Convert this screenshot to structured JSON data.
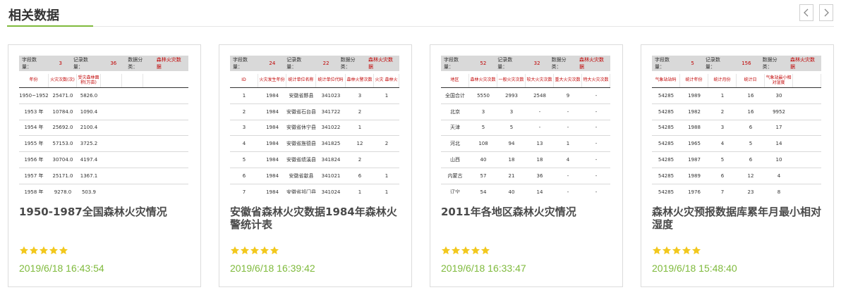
{
  "section": {
    "title": "相关数据",
    "accent_color": "#7fba3c"
  },
  "nav": {
    "prev_icon": "chevron-left-icon",
    "next_icon": "chevron-right-icon"
  },
  "meta_labels": {
    "fields": "字段数量：",
    "records": "记录数量：",
    "category": "数据分类："
  },
  "cards": [
    {
      "title": "1950-1987全国森林火灾情况",
      "date": "2019/6/18 16:43:54",
      "rating": 5,
      "thumb": {
        "fields": "3",
        "records": "36",
        "category": "森林火灾数据",
        "columns": [
          "年份",
          "火灾次数(次)",
          "受灾森林面积(万亩)",
          "",
          ""
        ],
        "rows": [
          [
            "1950~1952",
            "25471.0",
            "5826.0",
            "",
            ""
          ],
          [
            "1953 年",
            "10784.0",
            "1090.4",
            "",
            ""
          ],
          [
            "1954 年",
            "25692.0",
            "2100.4",
            "",
            ""
          ],
          [
            "1955 年",
            "57153.0",
            "3725.2",
            "",
            ""
          ],
          [
            "1956 年",
            "30704.0",
            "4197.4",
            "",
            ""
          ],
          [
            "1957 年",
            "25171.0",
            "1367.1",
            "",
            ""
          ],
          [
            "1958 年",
            "9278.0",
            "503.9",
            "",
            ""
          ]
        ]
      }
    },
    {
      "title": "安徽省森林火灾数据1984年森林火警统计表",
      "date": "2019/6/18 16:39:42",
      "rating": 5,
      "thumb": {
        "fields": "24",
        "records": "22",
        "category": "森林火灾数据",
        "columns": [
          "ID",
          "火灾发生年份",
          "统计单位名称",
          "统计单位代码",
          "森林火警次数",
          "火灾 森林火"
        ],
        "rows": [
          [
            "1",
            "1984",
            "安徽省黟县",
            "341023",
            "3",
            "1"
          ],
          [
            "2",
            "1984",
            "安徽省石台县",
            "341722",
            "2",
            ""
          ],
          [
            "3",
            "1984",
            "安徽省休宁县",
            "341022",
            "1",
            ""
          ],
          [
            "4",
            "1984",
            "安徽省旌德县",
            "341825",
            "12",
            "2"
          ],
          [
            "5",
            "1984",
            "安徽省绩溪县",
            "341824",
            "2",
            ""
          ],
          [
            "6",
            "1984",
            "安徽省歙县",
            "341021",
            "6",
            "1"
          ],
          [
            "7",
            "1984",
            "安徽省祁门县",
            "341024",
            "1",
            "1"
          ]
        ]
      }
    },
    {
      "title": "2011年各地区森林火灾情况",
      "date": "2019/6/18 16:33:47",
      "rating": 5,
      "thumb": {
        "fields": "52",
        "records": "32",
        "category": "森林火灾数据",
        "columns": [
          "地区",
          "森林火灾次数",
          "一般火灾次数",
          "较大火灾次数",
          "重大火灾次数",
          "特大火灾次数"
        ],
        "rows": [
          [
            "全国合计",
            "5550",
            "2993",
            "2548",
            "9",
            "-"
          ],
          [
            "北京",
            "3",
            "3",
            "-",
            "-",
            "-"
          ],
          [
            "天津",
            "5",
            "5",
            "-",
            "-",
            "-"
          ],
          [
            "河北",
            "108",
            "94",
            "13",
            "1",
            "-"
          ],
          [
            "山西",
            "40",
            "18",
            "18",
            "4",
            "-"
          ],
          [
            "内蒙古",
            "57",
            "21",
            "36",
            "-",
            "-"
          ],
          [
            "辽宁",
            "54",
            "40",
            "14",
            "-",
            "-"
          ]
        ]
      }
    },
    {
      "title": "森林火灾预报数据库累年月最小相对湿度",
      "date": "2019/6/18 15:48:40",
      "rating": 5,
      "thumb": {
        "fields": "5",
        "records": "156",
        "category": "森林火灾数据",
        "columns": [
          "气象站站码",
          "统计年份",
          "统计月份",
          "统计日",
          "气象站最小相对湿度",
          ""
        ],
        "rows": [
          [
            "54285",
            "1989",
            "1",
            "16",
            "30",
            ""
          ],
          [
            "54285",
            "1982",
            "2",
            "16",
            "9952",
            ""
          ],
          [
            "54285",
            "1988",
            "3",
            "6",
            "17",
            ""
          ],
          [
            "54285",
            "1965",
            "4",
            "5",
            "14",
            ""
          ],
          [
            "54285",
            "1987",
            "5",
            "6",
            "10",
            ""
          ],
          [
            "54285",
            "1989",
            "6",
            "12",
            "4",
            ""
          ],
          [
            "54285",
            "1976",
            "7",
            "23",
            "8",
            ""
          ]
        ]
      }
    }
  ]
}
